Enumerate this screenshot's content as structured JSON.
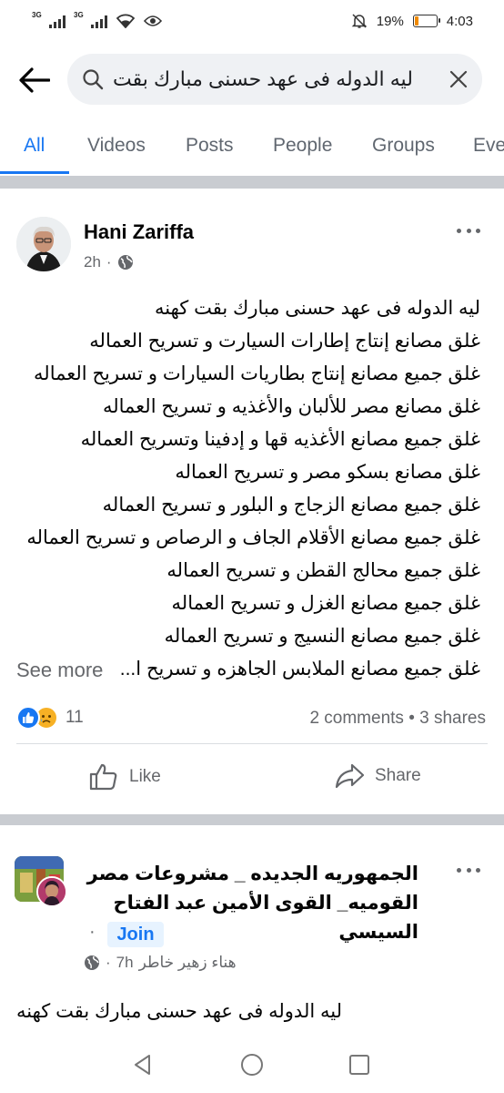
{
  "status_bar": {
    "signal_1": "3G",
    "signal_2": "3G",
    "battery_percent": "19%",
    "battery_level": 0.19,
    "time": "4:03"
  },
  "search": {
    "query": "ليه الدوله فى عهد حسنى مبارك بقت"
  },
  "tabs": [
    "All",
    "Videos",
    "Posts",
    "People",
    "Groups",
    "Eve"
  ],
  "post1": {
    "author": "Hani Zariffa",
    "time": "2h",
    "lines": [
      "ليه الدوله فى عهد حسنى مبارك بقت كهنه",
      "غلق مصانع إنتاج إطارات السيارت و تسريح العماله",
      "غلق جميع مصانع إنتاج بطاريات السيارات و تسريح العماله",
      "غلق مصانع مصر للألبان والأغذيه و تسريح العماله",
      "غلق جميع مصانع الأغذيه قها و إدفينا وتسريح العماله",
      "غلق مصانع بسكو مصر و تسريح العماله",
      "غلق جميع مصانع الزجاج و البلور و تسريح العماله",
      "غلق جميع مصانع الأقلام الجاف و الرصاص و تسريح العماله",
      "غلق جميع محالج القطن و تسريح العماله",
      "غلق جميع مصانع الغزل و تسريح العماله",
      "غلق جميع مصانع النسيج و تسريح العماله",
      "غلق جميع مصانع الملابس الجاهزه و تسريح ا..."
    ],
    "see_more": "See more",
    "reaction_count": "11",
    "stats": "2 comments • 3 shares",
    "like_label": "Like",
    "share_label": "Share"
  },
  "post2": {
    "group_name": "الجمهوريه الجديده _ مشروعات مصر القوميه_ القوى الأمين عبد الفتاح السيسي",
    "join_label": "Join",
    "author": "هناء زهير خاطر",
    "time": "7h",
    "first_line": "ليه الدوله فى عهد حسنى مبارك بقت كهنه"
  }
}
